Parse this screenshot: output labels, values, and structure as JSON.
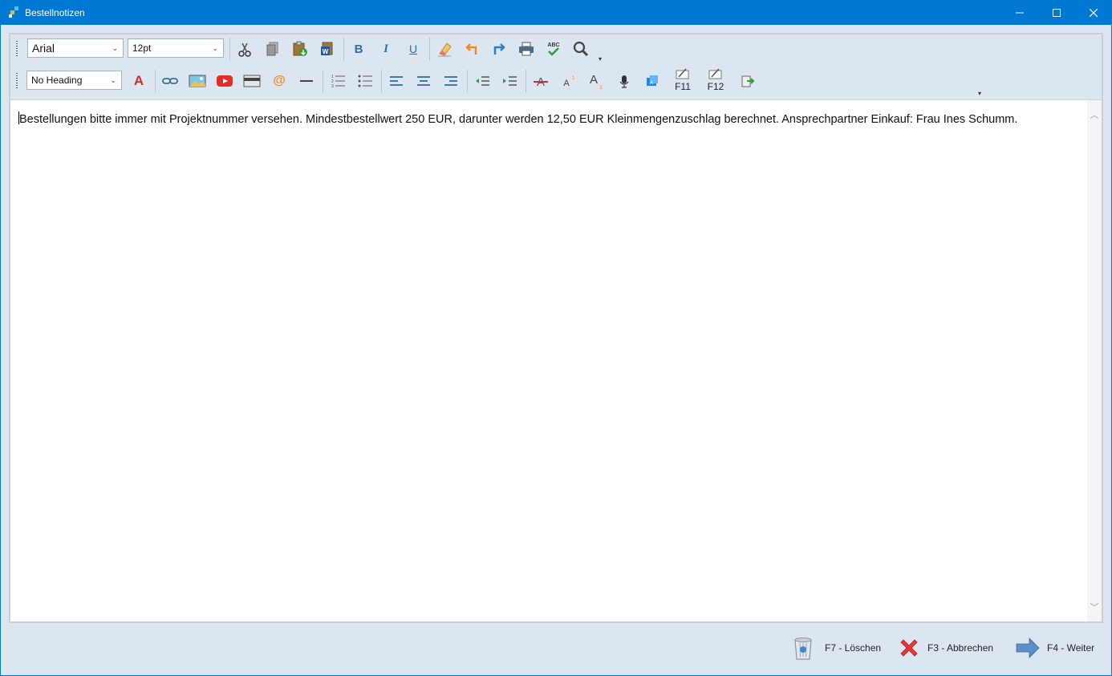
{
  "window": {
    "title": "Bestellnotizen"
  },
  "toolbar": {
    "font_family": "Arial",
    "font_size": "12pt",
    "heading": "No Heading",
    "row1_icons": [
      "cut-icon",
      "copy-icon",
      "paste-icon",
      "paste-word-icon",
      "bold-icon",
      "italic-icon",
      "underline-icon",
      "clear-format-icon",
      "undo-icon",
      "redo-icon",
      "print-icon",
      "spellcheck-icon",
      "search-icon"
    ],
    "row2_icons": [
      "font-color-icon",
      "link-icon",
      "image-icon",
      "youtube-icon",
      "card-icon",
      "email-icon",
      "horizontal-rule-icon",
      "numbered-list-icon",
      "bullet-list-icon",
      "align-left-icon",
      "align-center-icon",
      "align-right-icon",
      "outdent-icon",
      "indent-icon",
      "strikethrough-icon",
      "superscript-icon",
      "subscript-icon",
      "microphone-icon",
      "translate-icon",
      "f11-icon",
      "f12-icon",
      "export-icon"
    ],
    "bold_label": "B",
    "italic_label": "I",
    "underline_label": "U",
    "font_color_label": "A",
    "f11_label": "F11",
    "f12_label": "F12",
    "accent_red": "#d32f2f",
    "accent_blue": "#2c6ea8"
  },
  "editor": {
    "text": "Bestellungen bitte immer mit Projektnummer versehen. Mindestbestellwert 250 EUR, darunter werden 12,50 EUR Kleinmengenzuschlag berechnet. Ansprechpartner Einkauf: Frau Ines Schumm."
  },
  "footer": {
    "delete_label": "F7 - Löschen",
    "cancel_label": "F3 - Abbrechen",
    "next_label": "F4 - Weiter"
  }
}
